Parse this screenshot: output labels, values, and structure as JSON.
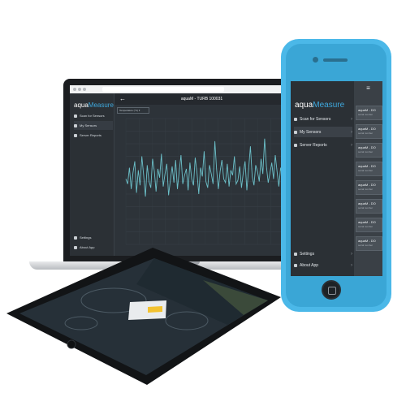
{
  "laptop": {
    "brand_prefix": "aqua",
    "brand_suffix": "Measure",
    "window_title": "aquaM - TURB 100031",
    "back_glyph": "←",
    "selector_value": "Temperature (°C) ▾",
    "menu": [
      {
        "label": "Scan for Sensors",
        "icon": "scan-icon"
      },
      {
        "label": "My Sensors",
        "icon": "sensors-icon"
      },
      {
        "label": "Server Reports",
        "icon": "cloud-icon"
      }
    ],
    "footer_menu": [
      {
        "label": "Settings",
        "icon": "gear-icon"
      },
      {
        "label": "About App",
        "icon": "help-icon"
      }
    ]
  },
  "phone": {
    "brand_prefix": "aqua",
    "brand_suffix": "Measure",
    "hamburger_glyph": "≡",
    "chevron_glyph": "›",
    "menu": [
      {
        "label": "Scan for Sensors",
        "icon": "scan-icon"
      },
      {
        "label": "My Sensors",
        "icon": "sensors-icon"
      },
      {
        "label": "Server Reports",
        "icon": "cloud-icon"
      }
    ],
    "footer_menu": [
      {
        "label": "Settings",
        "icon": "gear-icon"
      },
      {
        "label": "About App",
        "icon": "help-icon"
      }
    ],
    "sensor_cards": [
      {
        "title": "aquaM - DO",
        "subtitle": "serial number"
      },
      {
        "title": "aquaM - DO",
        "subtitle": "serial number"
      },
      {
        "title": "aquaM - DO",
        "subtitle": "serial number"
      },
      {
        "title": "aquaM - DO",
        "subtitle": "serial number"
      },
      {
        "title": "aquaM - DO",
        "subtitle": "serial number"
      },
      {
        "title": "aquaM - DO",
        "subtitle": "serial number"
      },
      {
        "title": "aquaM - DO",
        "subtitle": "serial number"
      },
      {
        "title": "aquaM - DO",
        "subtitle": "serial number"
      }
    ]
  },
  "colors": {
    "accent": "#3fa9de",
    "chart_line": "#6cc0c9",
    "phone_body": "#4bb8e8",
    "app_background": "#2d3339"
  },
  "chart_data": {
    "type": "line",
    "title": "",
    "xlabel": "",
    "ylabel": "",
    "series": [
      {
        "values": [
          52,
          48,
          61,
          44,
          57,
          66,
          41,
          59,
          47,
          70,
          55,
          38,
          63,
          50,
          45,
          68,
          58,
          42,
          60,
          53,
          72,
          46,
          56,
          64,
          39,
          51,
          62,
          49,
          67,
          44,
          58,
          71,
          48,
          55,
          60,
          43,
          65,
          52,
          47,
          69,
          57,
          40,
          61,
          54,
          74,
          50,
          45,
          63,
          56,
          48,
          82,
          60,
          44,
          58,
          67,
          52,
          49,
          64,
          46,
          59,
          55,
          70,
          48,
          51,
          62,
          45,
          57,
          66,
          43,
          60,
          78,
          54,
          47,
          63,
          58,
          50,
          68,
          56,
          84,
          62,
          49,
          57,
          65,
          52,
          71,
          58,
          46,
          61,
          54,
          67
        ]
      }
    ],
    "ylim": [
      0,
      100
    ],
    "grid": true
  }
}
